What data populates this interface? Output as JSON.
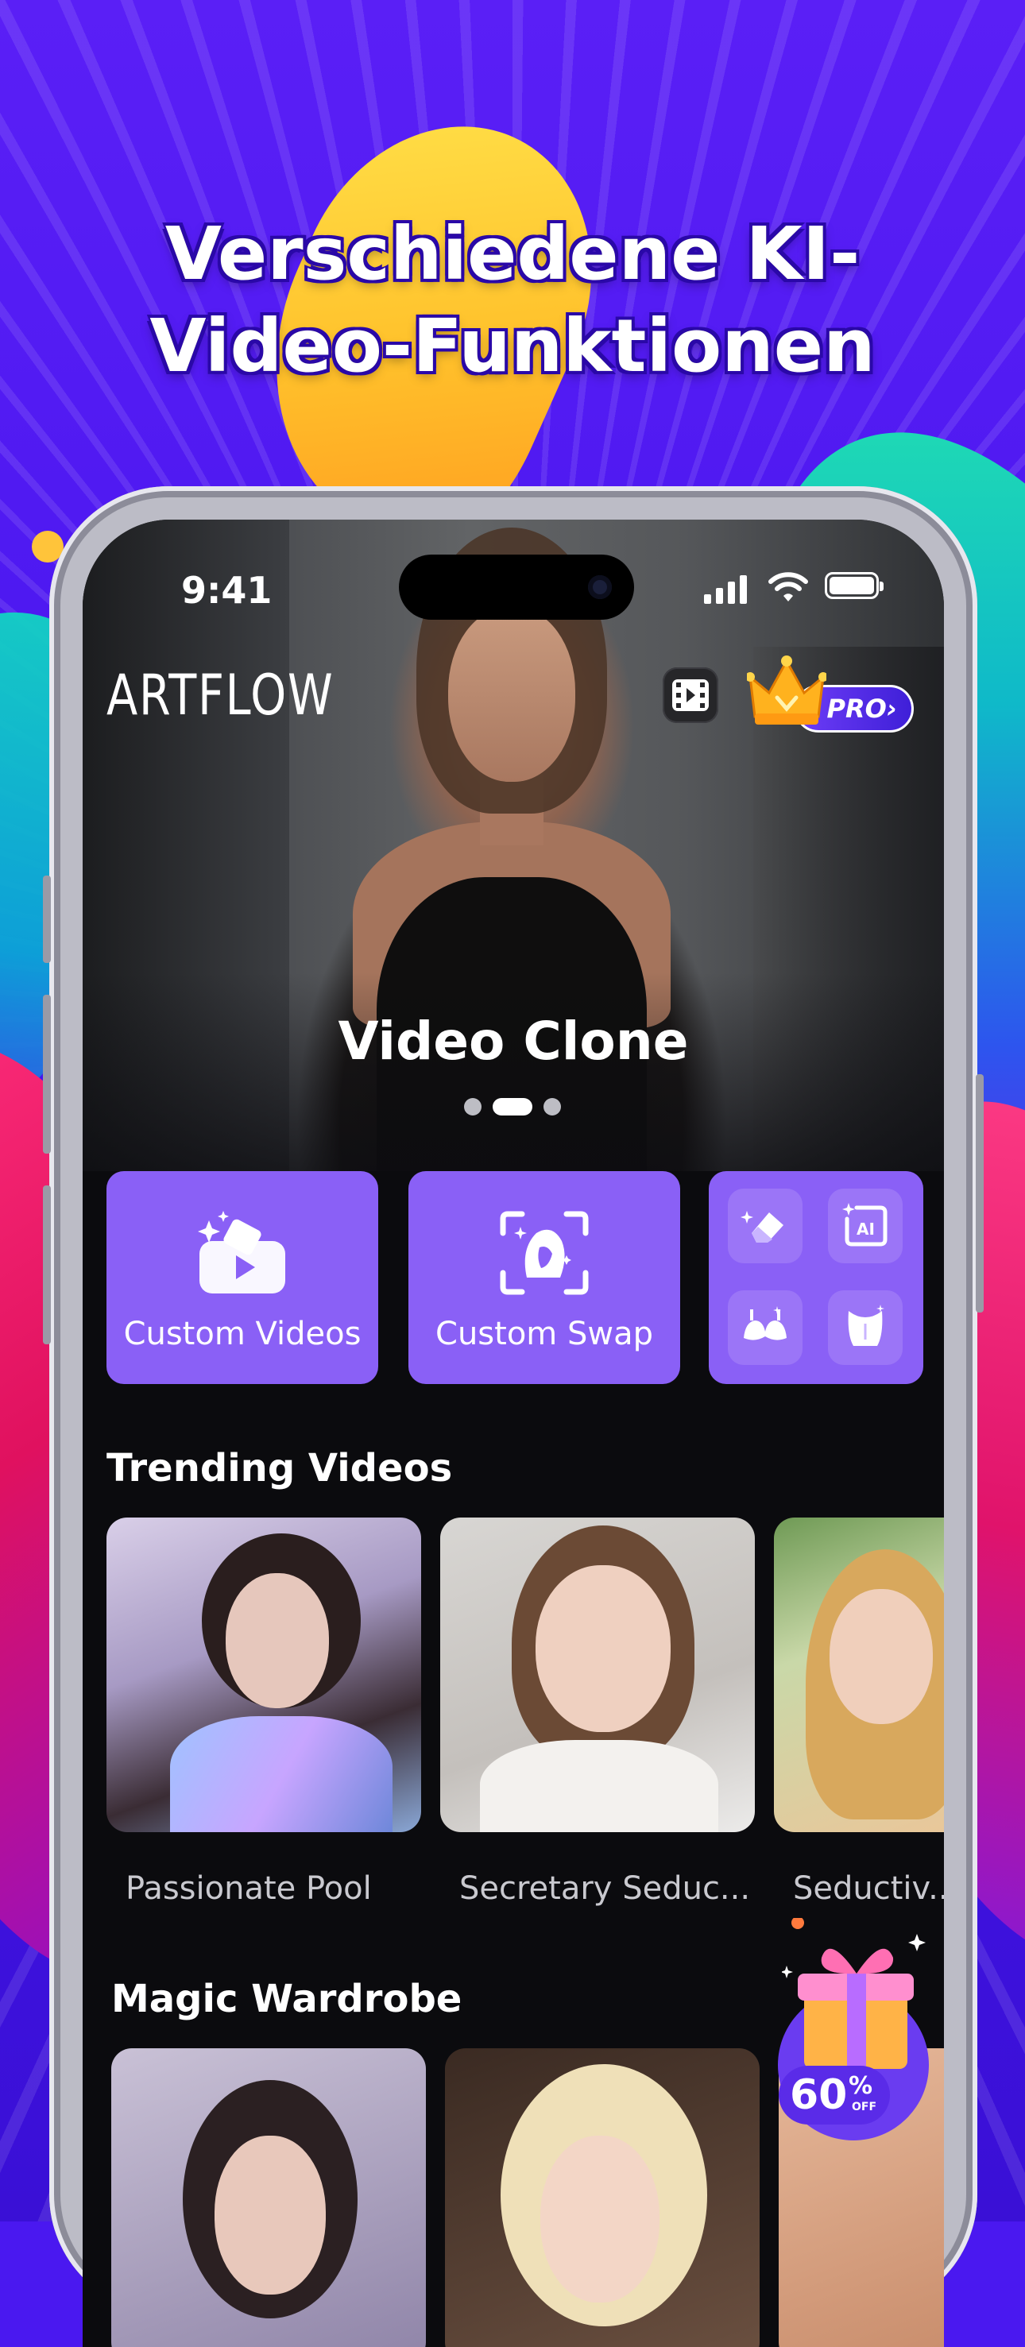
{
  "headline": {
    "line1": "Verschiedene KI-",
    "line2": "Video-Funktionen"
  },
  "status_bar": {
    "time": "9:41"
  },
  "header": {
    "logo": "ARTFLOW",
    "pro_label": "PRO›"
  },
  "hero": {
    "title": "Video Clone",
    "pager": {
      "count": 3,
      "active": 1
    }
  },
  "quick_actions": [
    {
      "label": "Custom Videos",
      "icon": "video-sparkle-icon"
    },
    {
      "label": "Custom Swap",
      "icon": "face-scan-icon"
    }
  ],
  "tools_grid": [
    {
      "icon": "eraser-icon"
    },
    {
      "icon": "ai-image-icon"
    },
    {
      "icon": "bra-icon"
    },
    {
      "icon": "body-icon"
    }
  ],
  "trending": {
    "title": "Trending Videos",
    "items": [
      {
        "label": "Passionate Pool"
      },
      {
        "label": "Secretary Seduc..."
      },
      {
        "label": "Seductiv.."
      }
    ]
  },
  "wardrobe": {
    "title": "Magic Wardrobe"
  },
  "promo": {
    "discount": "60",
    "percent": "%",
    "off": "OFF"
  },
  "colors": {
    "accent": "#8a60f6",
    "background": "#4a18f0",
    "screen": "#0b0b0e"
  }
}
